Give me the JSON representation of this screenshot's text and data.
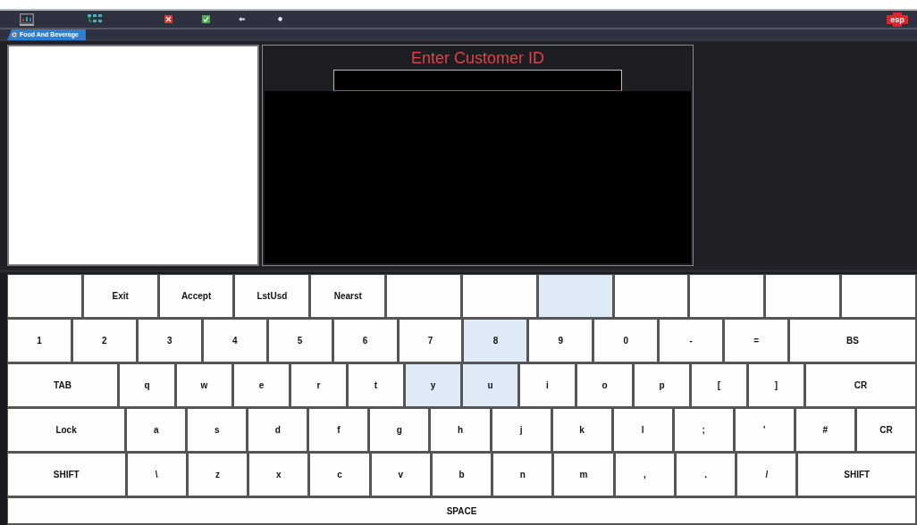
{
  "toolbar": {
    "items": [
      {
        "kind": "monitor"
      },
      {
        "kind": "grid"
      },
      {
        "kind": "cancel"
      },
      {
        "kind": "accept"
      },
      {
        "kind": "arrow"
      },
      {
        "kind": "pin"
      }
    ],
    "badge": "esp"
  },
  "tabs": [
    {
      "label": "Food And Beverage",
      "selected": true
    }
  ],
  "prompt": {
    "title": "Enter Customer ID"
  },
  "keyboard": {
    "rows": [
      [
        {
          "kind": "normal",
          "highlighted": false
        },
        {
          "label": "Exit",
          "kind": "normal",
          "highlighted": false
        },
        {
          "label": "Accept",
          "kind": "normal",
          "highlighted": false
        },
        {
          "label": "LstUsd",
          "kind": "normal",
          "highlighted": false
        },
        {
          "label": "Nearst",
          "kind": "normal",
          "highlighted": false
        },
        {
          "kind": "normal",
          "highlighted": false
        },
        {
          "kind": "normal",
          "highlighted": false
        },
        {
          "kind": "normal",
          "highlighted": true
        },
        {
          "kind": "normal",
          "highlighted": false
        },
        {
          "kind": "normal",
          "highlighted": false
        },
        {
          "kind": "normal",
          "highlighted": false
        },
        {
          "kind": "normal",
          "highlighted": false
        }
      ],
      [
        {
          "label": "1",
          "kind": "normal",
          "highlighted": false
        },
        {
          "label": "2",
          "kind": "normal",
          "highlighted": false
        },
        {
          "label": "3",
          "kind": "normal",
          "highlighted": false
        },
        {
          "label": "4",
          "kind": "normal",
          "highlighted": false
        },
        {
          "label": "5",
          "kind": "normal",
          "highlighted": false
        },
        {
          "label": "6",
          "kind": "normal",
          "highlighted": false
        },
        {
          "label": "7",
          "kind": "normal",
          "highlighted": false
        },
        {
          "label": "8",
          "kind": "normal",
          "highlighted": true
        },
        {
          "label": "9",
          "kind": "normal",
          "highlighted": false
        },
        {
          "label": "0",
          "kind": "normal",
          "highlighted": false
        },
        {
          "label": "-",
          "kind": "normal",
          "highlighted": false
        },
        {
          "label": "=",
          "kind": "normal",
          "highlighted": false
        },
        {
          "label": "BS",
          "kind": "wide",
          "highlighted": false
        }
      ],
      [
        {
          "label": "TAB",
          "kind": "wide",
          "highlighted": false
        },
        {
          "label": "q",
          "kind": "normal",
          "highlighted": false
        },
        {
          "label": "w",
          "kind": "normal",
          "highlighted": false
        },
        {
          "label": "e",
          "kind": "normal",
          "highlighted": false
        },
        {
          "label": "r",
          "kind": "normal",
          "highlighted": false
        },
        {
          "label": "t",
          "kind": "normal",
          "highlighted": false
        },
        {
          "label": "y",
          "kind": "normal",
          "highlighted": true
        },
        {
          "label": "u",
          "kind": "normal",
          "highlighted": true
        },
        {
          "label": "i",
          "kind": "normal",
          "highlighted": false
        },
        {
          "label": "o",
          "kind": "normal",
          "highlighted": false
        },
        {
          "label": "p",
          "kind": "normal",
          "highlighted": false
        },
        {
          "label": "[",
          "kind": "normal",
          "highlighted": false
        },
        {
          "label": "]",
          "kind": "normal",
          "highlighted": false
        },
        {
          "label": "CR",
          "kind": "wide",
          "highlighted": false
        }
      ],
      [
        {
          "label": "Lock",
          "kind": "wide",
          "highlighted": false
        },
        {
          "label": "a",
          "kind": "normal",
          "highlighted": false
        },
        {
          "label": "s",
          "kind": "normal",
          "highlighted": false
        },
        {
          "label": "d",
          "kind": "normal",
          "highlighted": false
        },
        {
          "label": "f",
          "kind": "normal",
          "highlighted": false
        },
        {
          "label": "g",
          "kind": "normal",
          "highlighted": false
        },
        {
          "label": "h",
          "kind": "normal",
          "highlighted": false
        },
        {
          "label": "j",
          "kind": "normal",
          "highlighted": false
        },
        {
          "label": "k",
          "kind": "normal",
          "highlighted": false
        },
        {
          "label": "l",
          "kind": "normal",
          "highlighted": false
        },
        {
          "label": ";",
          "kind": "normal",
          "highlighted": false
        },
        {
          "label": "'",
          "kind": "normal",
          "highlighted": false
        },
        {
          "label": "#",
          "kind": "normal",
          "highlighted": false
        },
        {
          "label": "CR",
          "kind": "normal",
          "highlighted": false
        }
      ],
      [
        {
          "label": "SHIFT",
          "kind": "wide",
          "highlighted": false
        },
        {
          "label": "\\",
          "kind": "normal",
          "highlighted": false
        },
        {
          "label": "z",
          "kind": "normal",
          "highlighted": false
        },
        {
          "label": "x",
          "kind": "normal",
          "highlighted": false
        },
        {
          "label": "c",
          "kind": "normal",
          "highlighted": false
        },
        {
          "label": "v",
          "kind": "normal",
          "highlighted": false
        },
        {
          "label": "b",
          "kind": "normal",
          "highlighted": false
        },
        {
          "label": "n",
          "kind": "normal",
          "highlighted": false
        },
        {
          "label": "m",
          "kind": "normal",
          "highlighted": false
        },
        {
          "label": ",",
          "kind": "normal",
          "highlighted": false
        },
        {
          "label": ".",
          "kind": "normal",
          "highlighted": false
        },
        {
          "label": "/",
          "kind": "normal",
          "highlighted": false
        },
        {
          "label": "SHIFT",
          "kind": "wide",
          "highlighted": false
        }
      ],
      [
        {
          "label": "SPACE",
          "kind": "normal",
          "highlighted": false
        }
      ]
    ]
  }
}
